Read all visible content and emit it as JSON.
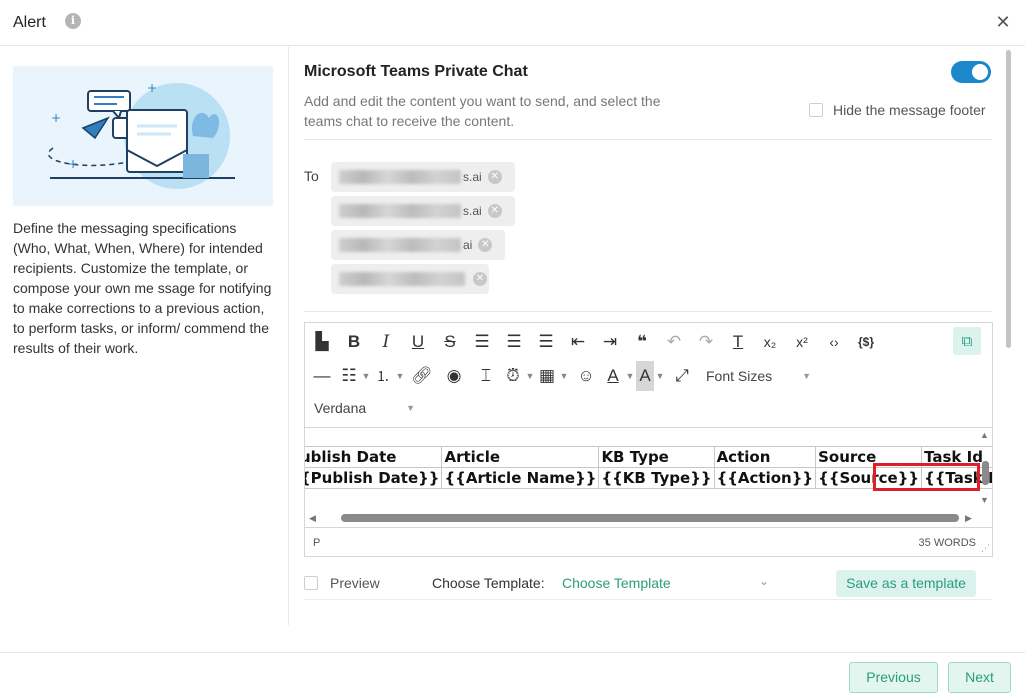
{
  "dialog": {
    "title": "Alert",
    "info_icon": "info-icon",
    "close_icon": "close-icon",
    "close_glyph": "✕"
  },
  "left_panel": {
    "description": "Define the messaging specifications (Who, What, When, Where) for intended recipients. Customize the template, or compose your own me ssage for notifying to make corrections to a previous action, to perform tasks, or inform/ commend the results of their work."
  },
  "section": {
    "title": "Microsoft Teams Private Chat",
    "toggle_on": true,
    "description": "Add and edit the content you want to send, and select the teams chat to receive the content.",
    "hide_footer_label": "Hide the message footer"
  },
  "recipients": {
    "to_label": "To",
    "chips": [
      {
        "visible_suffix": "s.ai"
      },
      {
        "visible_suffix": "s.ai"
      },
      {
        "visible_suffix": "ai"
      },
      {
        "visible_suffix": ""
      }
    ]
  },
  "editor": {
    "toolbar_row1_icons": [
      "paragraph-icon",
      "bold-icon",
      "italic-icon",
      "underline-icon",
      "strikethrough-icon",
      "align-left-icon",
      "align-center-icon",
      "align-right-icon",
      "outdent-icon",
      "indent-icon",
      "blockquote-icon",
      "undo-icon",
      "redo-icon",
      "clear-format-icon",
      "subscript-icon",
      "superscript-icon",
      "code-icon",
      "variable-icon"
    ],
    "toolbar_row2_icons": [
      "horizontal-rule-icon",
      "bullet-list-icon",
      "numbered-list-icon",
      "link-icon",
      "preview-eye-icon",
      "page-break-icon",
      "alarm-icon",
      "table-icon",
      "emoji-icon",
      "font-color-icon",
      "highlight-color-icon",
      "fullscreen-icon"
    ],
    "font_sizes_label": "Font Sizes",
    "font_family_label": "Verdana",
    "table": {
      "headers": [
        "ublish Date",
        "Article",
        "KB Type",
        "Action",
        "Source",
        "Task Id"
      ],
      "row": [
        "{Publish Date}}",
        "{{Article Name}}",
        "{{KB Type}}",
        "{{Action}}",
        "{{Source}}",
        "{{Task Id}}"
      ],
      "highlighted_cell": "{{Task Id}}",
      "highlight_color": "#e01e27"
    },
    "status_path": "P",
    "word_count": "35 WORDS"
  },
  "template_row": {
    "preview_label": "Preview",
    "choose_label": "Choose Template:",
    "choose_value": "Choose Template",
    "save_button": "Save as a template"
  },
  "footer": {
    "previous_button": "Previous",
    "next_button": "Next"
  },
  "colors": {
    "accent": "#1a88c9",
    "brand_green": "#2a9d7c",
    "light_green_bg": "#e3f5ef",
    "highlight_red": "#e01e27"
  }
}
